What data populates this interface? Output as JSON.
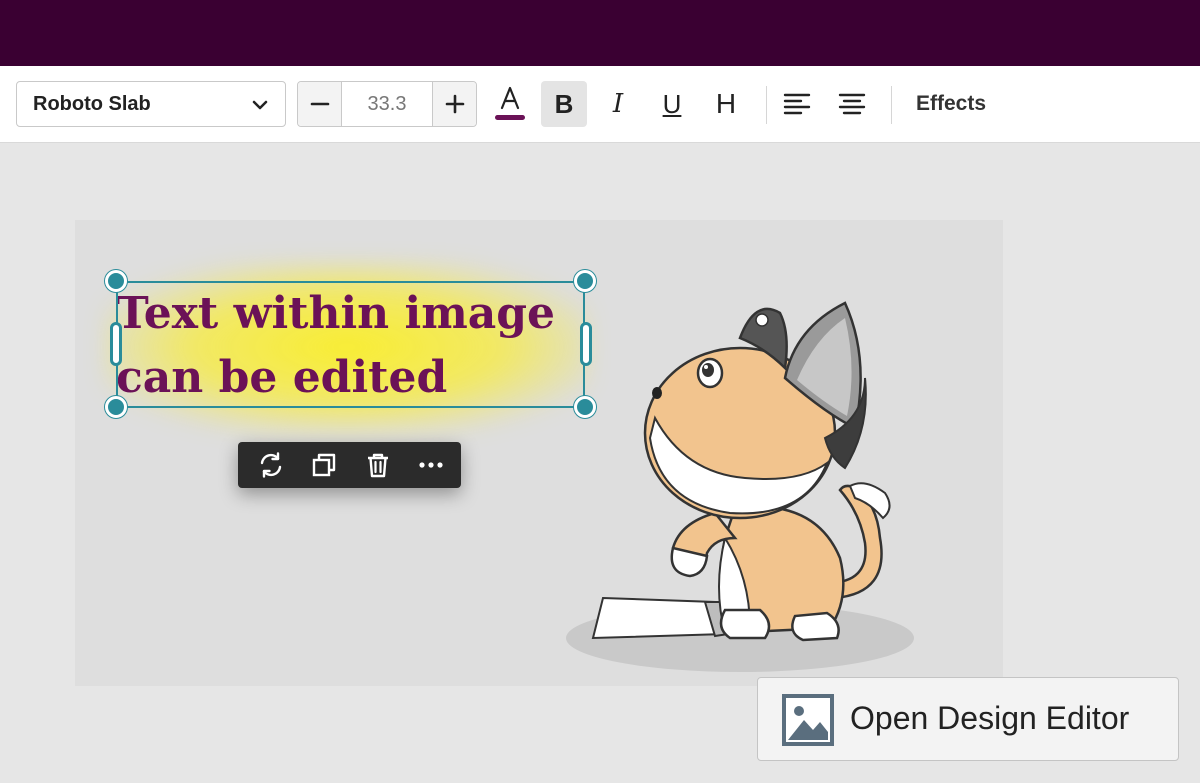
{
  "colors": {
    "topbar": "#3a0032",
    "accent": "#2a8c9a",
    "text_color_swatch": "#6b1257",
    "selected_text": "#6b1257",
    "text_glow": "#f5ea3c"
  },
  "toolbar": {
    "font_family": "Roboto Slab",
    "font_size": "33.3",
    "buttons": {
      "bold": "B",
      "italic": "I",
      "underline": "U",
      "heading": "H"
    },
    "effects_label": "Effects"
  },
  "canvas": {
    "text_lines": [
      "Text within image",
      "can be edited"
    ]
  },
  "context_menu": {
    "items": [
      "refresh-icon",
      "duplicate-icon",
      "trash-icon",
      "more-icon"
    ]
  },
  "open_editor_label": "Open Design Editor"
}
